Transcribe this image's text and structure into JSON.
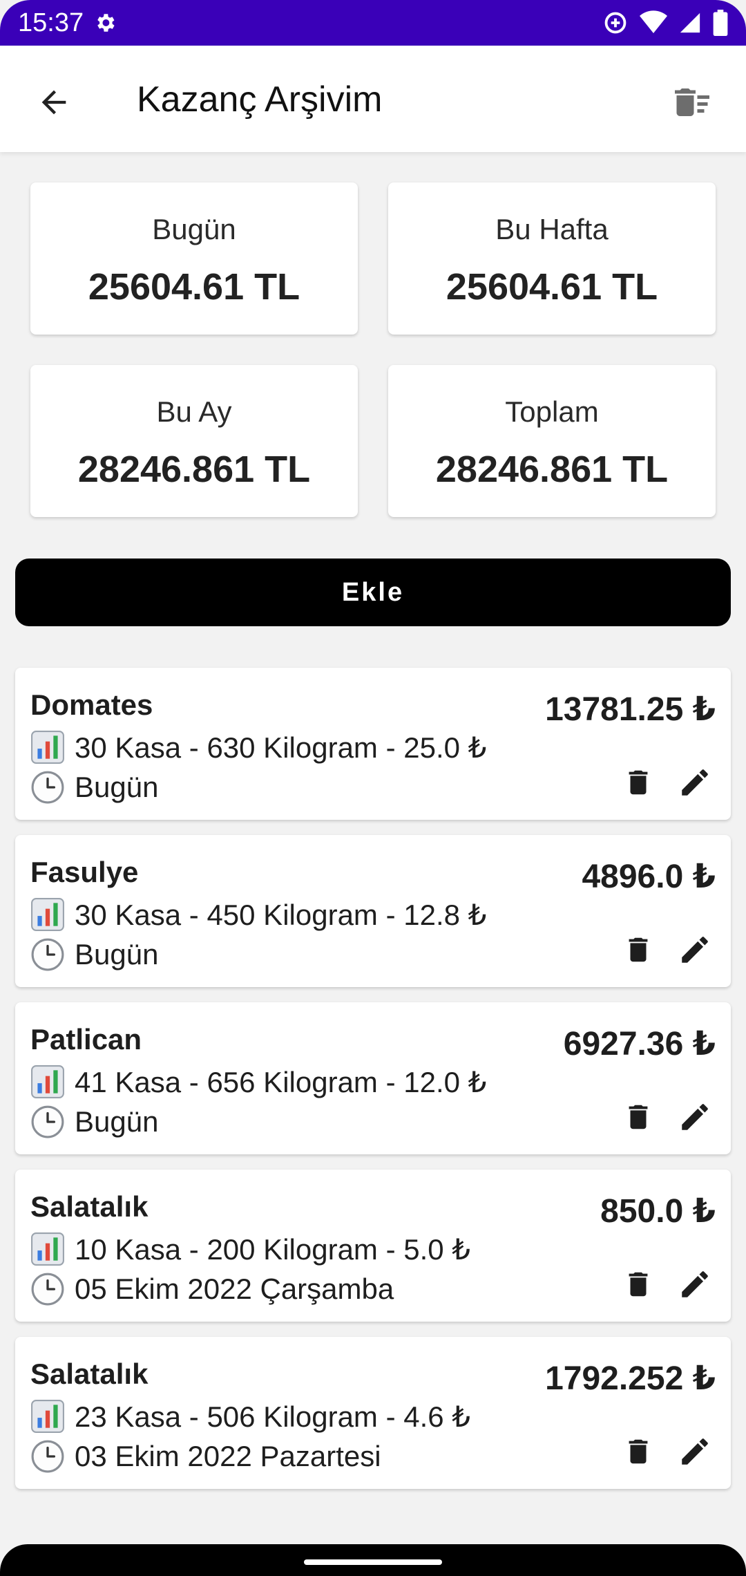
{
  "status_bar": {
    "time": "15:37"
  },
  "app_bar": {
    "title": "Kazanç Arşivim"
  },
  "stats": [
    {
      "label": "Bugün",
      "value": "25604.61 TL"
    },
    {
      "label": "Bu Hafta",
      "value": "25604.61 TL"
    },
    {
      "label": "Bu Ay",
      "value": "28246.861 TL"
    },
    {
      "label": "Toplam",
      "value": "28246.861 TL"
    }
  ],
  "add_button": {
    "label": "Ekle"
  },
  "entries": [
    {
      "name": "Domates",
      "details": "30 Kasa - 630 Kilogram - 25.0 ₺",
      "date": "Bugün",
      "amount": "13781.25 ₺"
    },
    {
      "name": "Fasulye",
      "details": "30 Kasa - 450 Kilogram - 12.8 ₺",
      "date": "Bugün",
      "amount": "4896.0 ₺"
    },
    {
      "name": "Patlican",
      "details": "41 Kasa - 656 Kilogram - 12.0 ₺",
      "date": "Bugün",
      "amount": "6927.36 ₺"
    },
    {
      "name": "Salatalık",
      "details": "10 Kasa - 200 Kilogram - 5.0 ₺",
      "date": "05 Ekim 2022 Çarşamba",
      "amount": "850.0 ₺"
    },
    {
      "name": "Salatalık",
      "details": "23 Kasa - 506 Kilogram - 4.6 ₺",
      "date": "03 Ekim 2022 Pazartesi",
      "amount": "1792.252 ₺"
    }
  ],
  "icons": {
    "back": "arrow-left-icon",
    "clear_all": "delete-sweep-icon",
    "chart": "bar-chart-icon",
    "clock": "clock-icon",
    "delete": "trash-icon",
    "edit": "pencil-icon"
  },
  "colors": {
    "status_bar": "#3a00b8",
    "button": "#000000",
    "card": "#ffffff",
    "background": "#f2f2f2"
  }
}
